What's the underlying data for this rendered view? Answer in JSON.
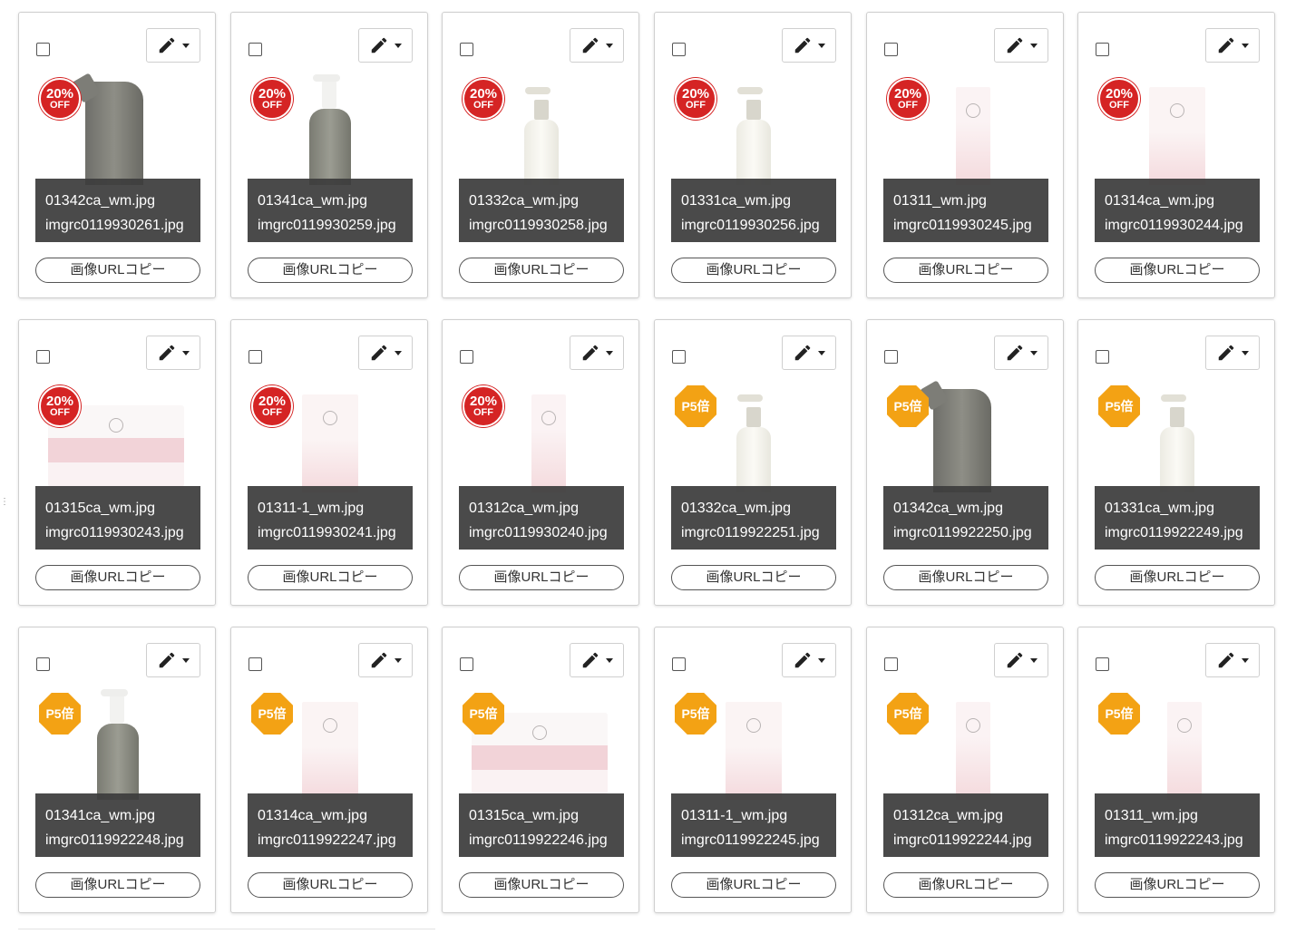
{
  "copy_label": "画像URLコピー",
  "badges": {
    "off": {
      "line1": "20%",
      "line2": "OFF"
    },
    "p5": {
      "line1": "P5倍"
    }
  },
  "colors": {
    "off_badge": "#d52424",
    "p5_badge": "#f3a214",
    "name_panel": "#3c3c3c"
  },
  "icons": {
    "edit": "pencil-icon",
    "dropdown": "caret-down-icon"
  },
  "cards": [
    {
      "file": "01342ca_wm.jpg",
      "img": "imgrc0119930261.jpg",
      "badge": "off",
      "product": "pouch"
    },
    {
      "file": "01341ca_wm.jpg",
      "img": "imgrc0119930259.jpg",
      "badge": "off",
      "product": "gbottle"
    },
    {
      "file": "01332ca_wm.jpg",
      "img": "imgrc0119930258.jpg",
      "badge": "off",
      "product": "wbottle"
    },
    {
      "file": "01331ca_wm.jpg",
      "img": "imgrc0119930256.jpg",
      "badge": "off",
      "product": "wbottle"
    },
    {
      "file": "01311_wm.jpg",
      "img": "imgrc0119930245.jpg",
      "badge": "off",
      "product": "ptube"
    },
    {
      "file": "01314ca_wm.jpg",
      "img": "imgrc0119930244.jpg",
      "badge": "off",
      "product": "pbox"
    },
    {
      "file": "01315ca_wm.jpg",
      "img": "imgrc0119930243.jpg",
      "badge": "off",
      "product": "jar"
    },
    {
      "file": "01311-1_wm.jpg",
      "img": "imgrc0119930241.jpg",
      "badge": "off",
      "product": "pbox"
    },
    {
      "file": "01312ca_wm.jpg",
      "img": "imgrc0119930240.jpg",
      "badge": "off",
      "product": "ptube"
    },
    {
      "file": "01332ca_wm.jpg",
      "img": "imgrc0119922251.jpg",
      "badge": "p5",
      "product": "wbottle"
    },
    {
      "file": "01342ca_wm.jpg",
      "img": "imgrc0119922250.jpg",
      "badge": "p5",
      "product": "pouch"
    },
    {
      "file": "01331ca_wm.jpg",
      "img": "imgrc0119922249.jpg",
      "badge": "p5",
      "product": "wbottle"
    },
    {
      "file": "01341ca_wm.jpg",
      "img": "imgrc0119922248.jpg",
      "badge": "p5",
      "product": "gbottle"
    },
    {
      "file": "01314ca_wm.jpg",
      "img": "imgrc0119922247.jpg",
      "badge": "p5",
      "product": "pbox"
    },
    {
      "file": "01315ca_wm.jpg",
      "img": "imgrc0119922246.jpg",
      "badge": "p5",
      "product": "jar"
    },
    {
      "file": "01311-1_wm.jpg",
      "img": "imgrc0119922245.jpg",
      "badge": "p5",
      "product": "pbox"
    },
    {
      "file": "01312ca_wm.jpg",
      "img": "imgrc0119922244.jpg",
      "badge": "p5",
      "product": "ptube"
    },
    {
      "file": "01311_wm.jpg",
      "img": "imgrc0119922243.jpg",
      "badge": "p5",
      "product": "ptube"
    }
  ]
}
